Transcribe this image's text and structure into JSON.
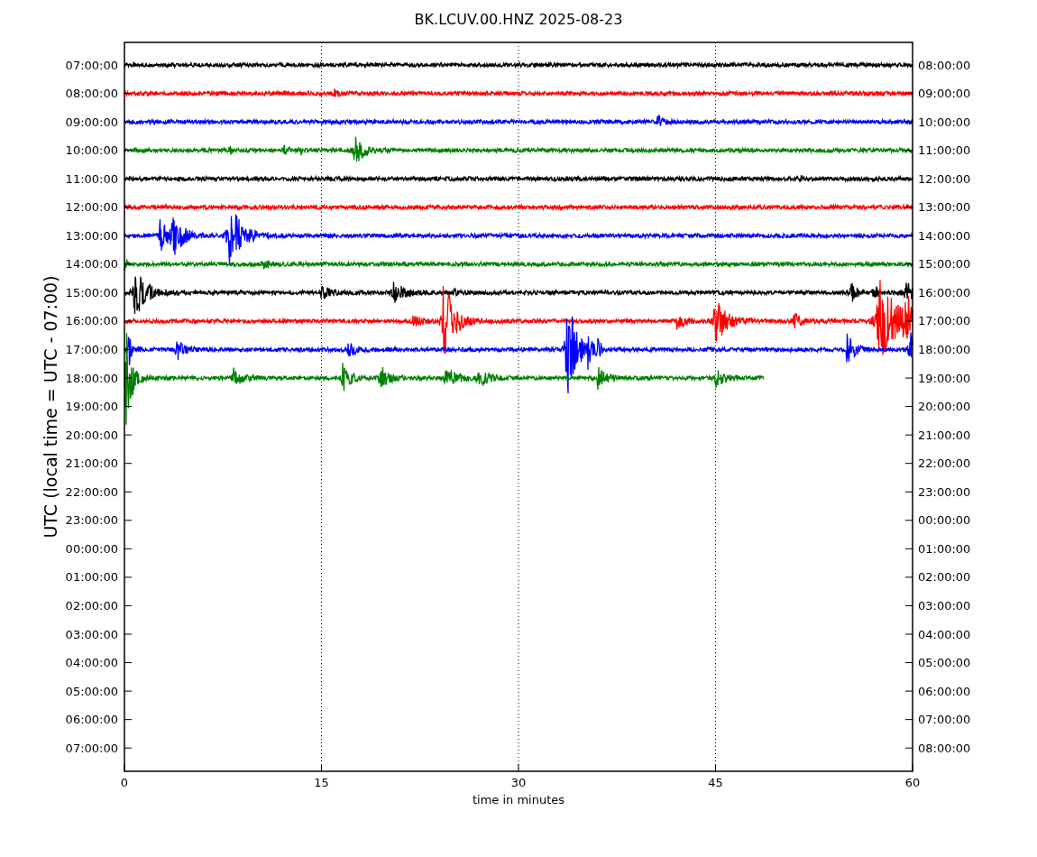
{
  "plot": {
    "title": "BK.LCUV.00.HNZ 2025-08-23",
    "ylabel": "UTC (local time = UTC - 07:00)",
    "xlabel": "time in minutes",
    "xticks": [
      "0",
      "15",
      "30",
      "45",
      "60"
    ],
    "left_labels": [
      "07:00:00",
      "08:00:00",
      "09:00:00",
      "10:00:00",
      "11:00:00",
      "12:00:00",
      "13:00:00",
      "14:00:00",
      "15:00:00",
      "16:00:00",
      "17:00:00",
      "18:00:00",
      "19:00:00",
      "20:00:00",
      "21:00:00",
      "22:00:00",
      "23:00:00",
      "00:00:00",
      "01:00:00",
      "02:00:00",
      "03:00:00",
      "04:00:00",
      "05:00:00",
      "06:00:00",
      "07:00:00"
    ],
    "right_labels": [
      "08:00:00",
      "09:00:00",
      "10:00:00",
      "11:00:00",
      "12:00:00",
      "13:00:00",
      "14:00:00",
      "15:00:00",
      "16:00:00",
      "17:00:00",
      "18:00:00",
      "19:00:00",
      "20:00:00",
      "21:00:00",
      "22:00:00",
      "23:00:00",
      "00:00:00",
      "01:00:00",
      "02:00:00",
      "03:00:00",
      "04:00:00",
      "05:00:00",
      "06:00:00",
      "07:00:00",
      "08:00:00"
    ],
    "traces": [
      {
        "color": "#000000"
      },
      {
        "color": "#ff0000"
      },
      {
        "color": "#0000ff"
      },
      {
        "color": "#008000"
      },
      {
        "color": "#000000"
      },
      {
        "color": "#ff0000"
      },
      {
        "color": "#0000ff"
      },
      {
        "color": "#008000"
      },
      {
        "color": "#000000"
      },
      {
        "color": "#ff0000"
      },
      {
        "color": "#0000ff"
      },
      {
        "color": "#008000"
      }
    ]
  }
}
